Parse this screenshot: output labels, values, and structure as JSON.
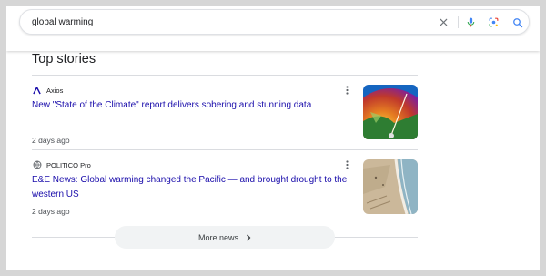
{
  "search": {
    "query": "global warming",
    "icons": [
      "close-icon",
      "microphone-icon",
      "lens-icon",
      "search-icon"
    ]
  },
  "section": {
    "title": "Top stories"
  },
  "stories": [
    {
      "source": "Axios",
      "source_icon": "axios-logo-icon",
      "headline": "New \"State of the Climate\" report delivers sobering and stunning data",
      "age": "2 days ago",
      "thumbnail": "climate-gauge-thumbnail"
    },
    {
      "source": "POLITICO Pro",
      "source_icon": "globe-icon",
      "headline": "E&E News: Global warming changed the Pacific — and brought drought to the western US",
      "age": "2 days ago",
      "thumbnail": "coastline-aerial-thumbnail"
    }
  ],
  "more": {
    "label": "More news"
  },
  "colors": {
    "link": "#1a0dab",
    "text": "#202124",
    "muted": "#4d5156",
    "divider": "#dadce0"
  }
}
